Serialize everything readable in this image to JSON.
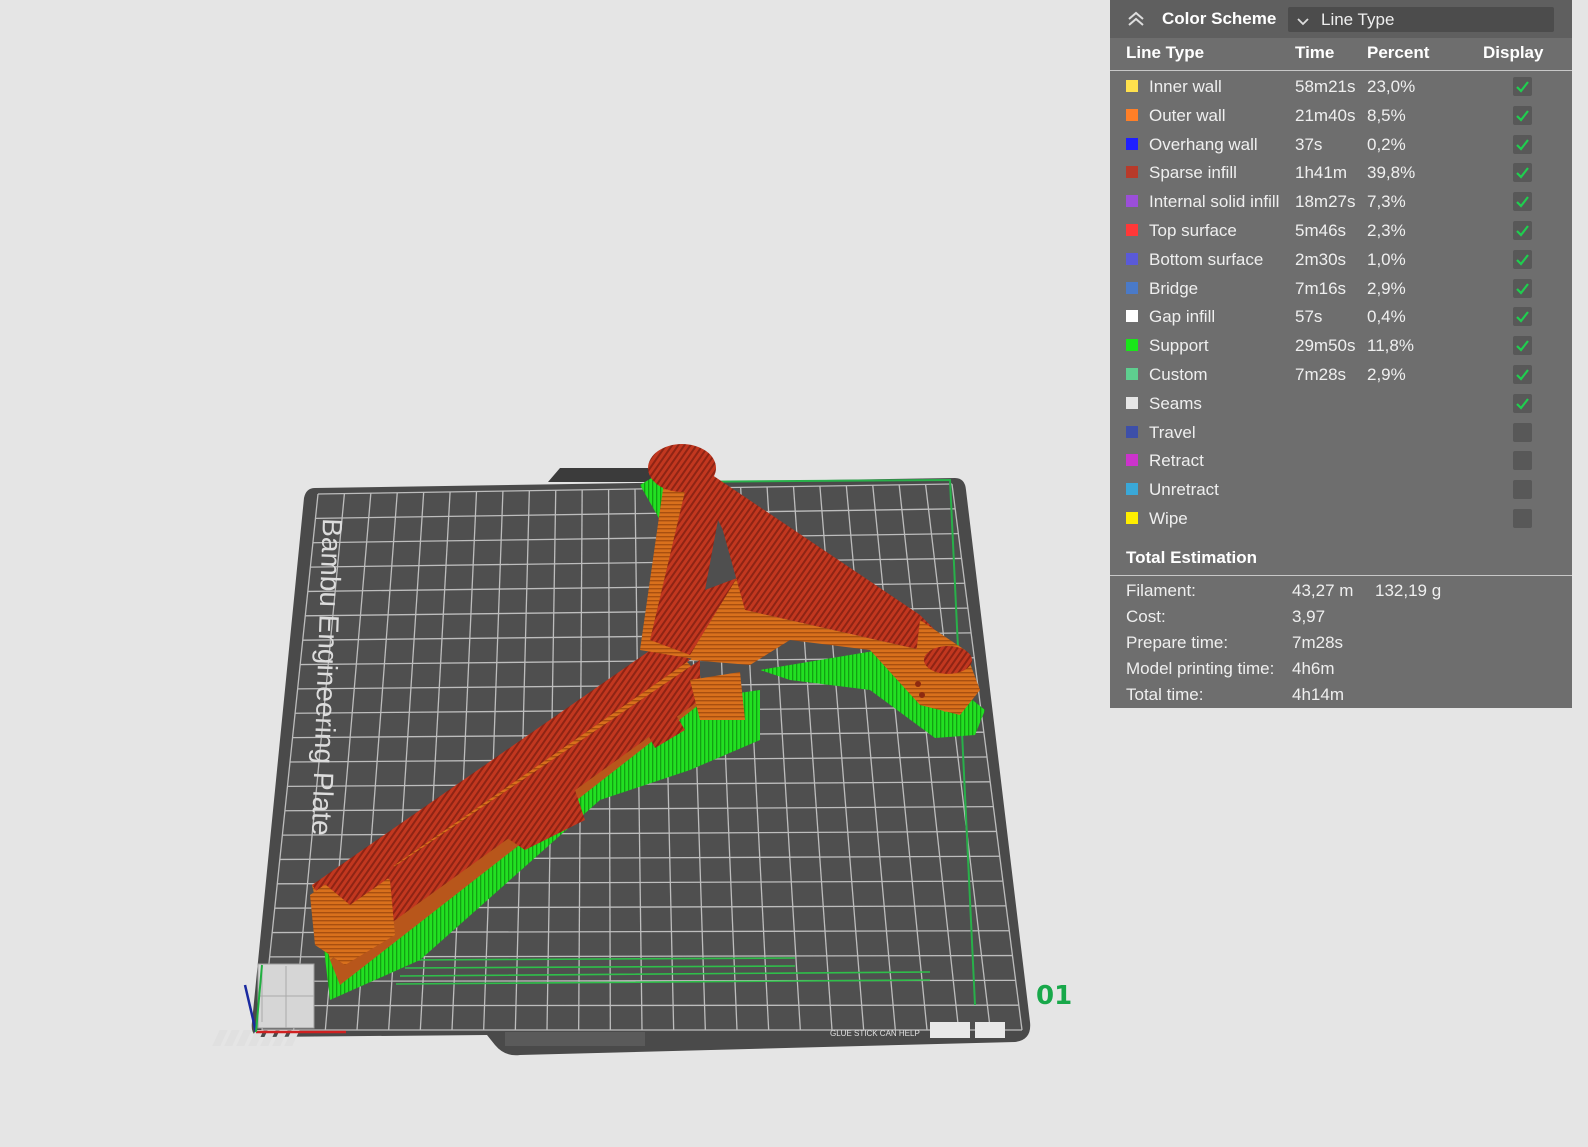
{
  "legend": {
    "title": "Color Scheme",
    "scheme_value": "Line Type",
    "headers": {
      "line_type": "Line Type",
      "time": "Time",
      "percent": "Percent",
      "display": "Display"
    },
    "items": [
      {
        "name": "Inner wall",
        "time": "58m21s",
        "percent": "23,0%",
        "color": "#ffe14d",
        "display": true
      },
      {
        "name": "Outer wall",
        "time": "21m40s",
        "percent": "8,5%",
        "color": "#ff7f27",
        "display": true
      },
      {
        "name": "Overhang wall",
        "time": "37s",
        "percent": "0,2%",
        "color": "#1f1fff",
        "display": true
      },
      {
        "name": "Sparse infill",
        "time": "1h41m",
        "percent": "39,8%",
        "color": "#b83a2a",
        "display": true
      },
      {
        "name": "Internal solid infill",
        "time": "18m27s",
        "percent": "7,3%",
        "color": "#9b4fd9",
        "display": true
      },
      {
        "name": "Top surface",
        "time": "5m46s",
        "percent": "2,3%",
        "color": "#ff3838",
        "display": true
      },
      {
        "name": "Bottom surface",
        "time": "2m30s",
        "percent": "1,0%",
        "color": "#5a5ad8",
        "display": true
      },
      {
        "name": "Bridge",
        "time": "7m16s",
        "percent": "2,9%",
        "color": "#4a7ac8",
        "display": true
      },
      {
        "name": "Gap infill",
        "time": "57s",
        "percent": "0,4%",
        "color": "#ffffff",
        "display": true
      },
      {
        "name": "Support",
        "time": "29m50s",
        "percent": "11,8%",
        "color": "#19e619",
        "display": true
      },
      {
        "name": "Custom",
        "time": "7m28s",
        "percent": "2,9%",
        "color": "#5ecf8f",
        "display": true
      },
      {
        "name": "Seams",
        "time": "",
        "percent": "",
        "color": "#e6e6e6",
        "display": true
      },
      {
        "name": "Travel",
        "time": "",
        "percent": "",
        "color": "#3d4fa8",
        "display": false
      },
      {
        "name": "Retract",
        "time": "",
        "percent": "",
        "color": "#cc33cc",
        "display": false
      },
      {
        "name": "Unretract",
        "time": "",
        "percent": "",
        "color": "#3aa8d8",
        "display": false
      },
      {
        "name": "Wipe",
        "time": "",
        "percent": "",
        "color": "#ffee00",
        "display": false
      }
    ],
    "total_title": "Total Estimation",
    "estimation": [
      {
        "label": "Filament:",
        "value": "43,27 m",
        "value2": "132,19 g"
      },
      {
        "label": "Cost:",
        "value": "3,97",
        "value2": ""
      },
      {
        "label": "Prepare time:",
        "value": "7m28s",
        "value2": ""
      },
      {
        "label": "Model printing time:",
        "value": "4h6m",
        "value2": ""
      },
      {
        "label": "Total time:",
        "value": "4h14m",
        "value2": ""
      }
    ]
  },
  "plate": {
    "name": "Bambu Engineering Plate",
    "number": "01",
    "front_text": "GLUE STICK CAN HELP"
  }
}
